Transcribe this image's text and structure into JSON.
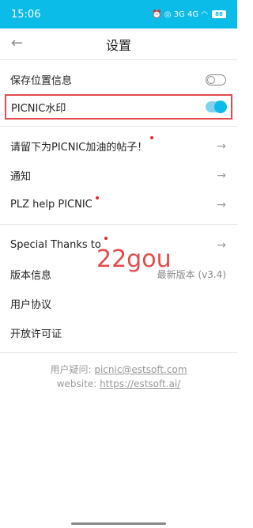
{
  "status": {
    "time": "15:06",
    "icons_text": "⏰ ◎ 3G 4G ◠",
    "battery": "88"
  },
  "header": {
    "title": "设置",
    "back_icon": "←"
  },
  "settings": {
    "save_location": "保存位置信息",
    "save_location_on": false,
    "watermark": "PICNIC水印",
    "watermark_on": true,
    "cheer_post": "请留下为PICNIC加油的帖子！",
    "notifications": "通知",
    "plz_help": "PLZ help PICNIC",
    "special_thanks": "Special Thanks to",
    "version_label": "版本信息",
    "version_value": "最新版本 (v3.4)",
    "user_agreement": "用户协议",
    "open_license": "开放许可证"
  },
  "arrow": "→",
  "watermark_overlay": "22gou",
  "footer": {
    "inquiry_label": "用户疑问: ",
    "inquiry_email": "picnic@estsoft.com",
    "website_label": "website: ",
    "website_url": "https://estsoft.ai/"
  },
  "colors": {
    "accent": "#0bbbe8",
    "highlight": "#e24b4b",
    "dot": "#e2262a"
  }
}
